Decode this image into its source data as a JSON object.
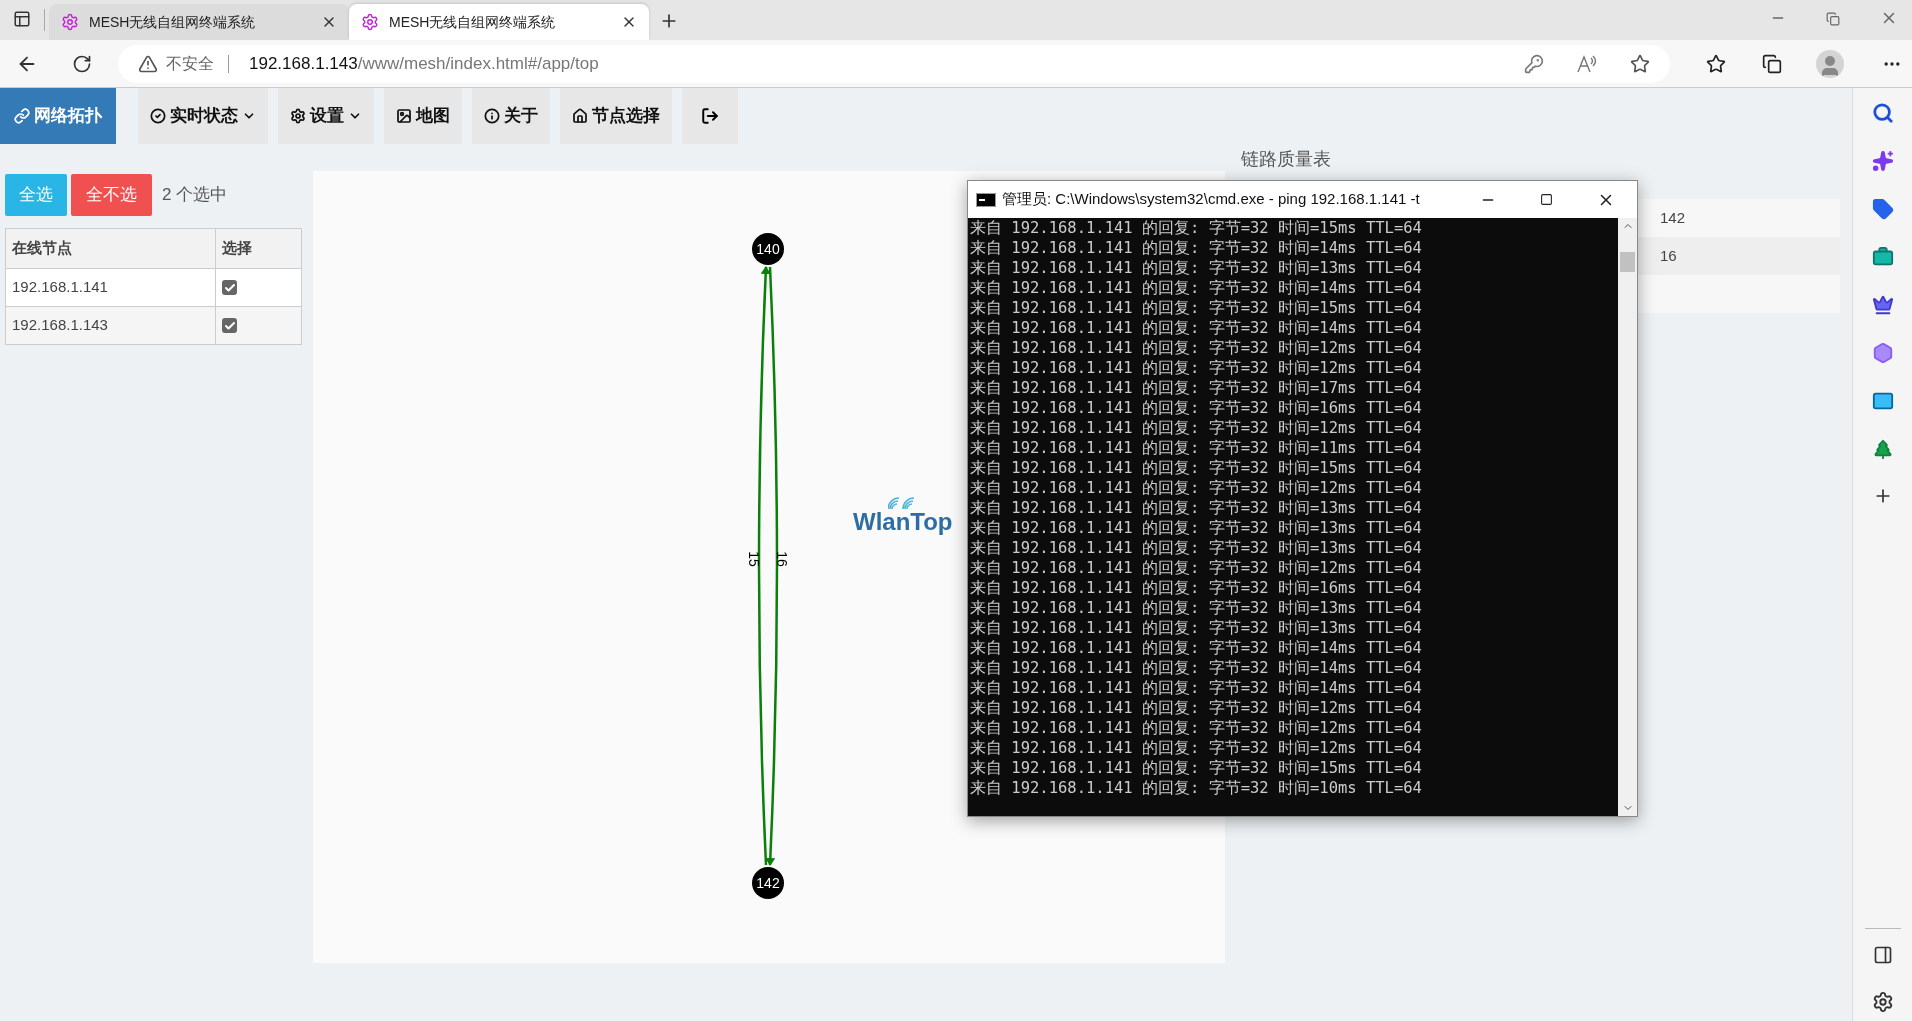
{
  "browser": {
    "tabs": [
      {
        "title": "MESH无线自组网终端系统",
        "selected": false
      },
      {
        "title": "MESH无线自组网终端系统",
        "selected": true
      }
    ],
    "security": "不安全",
    "url_host": "192.168.1.143",
    "url_path": "/www/mesh/index.html#/app/top"
  },
  "nav": [
    {
      "label": "网络拓扑",
      "dropdown": false,
      "selected": true
    },
    {
      "label": "实时状态",
      "dropdown": true,
      "selected": false
    },
    {
      "label": "设置",
      "dropdown": true,
      "selected": false
    },
    {
      "label": "地图",
      "dropdown": false,
      "selected": false
    },
    {
      "label": "关于",
      "dropdown": false,
      "selected": false
    },
    {
      "label": "节点选择",
      "dropdown": false,
      "selected": false
    }
  ],
  "node_panel": {
    "select_all": "全选",
    "select_none": "全不选",
    "selected_count": "2 个选中",
    "columns": [
      "在线节点",
      "选择"
    ],
    "rows": [
      {
        "ip": "192.168.1.141",
        "checked": true
      },
      {
        "ip": "192.168.1.143",
        "checked": true
      }
    ]
  },
  "graph": {
    "nodes": [
      "140",
      "142"
    ],
    "edges": [
      {
        "label": "15"
      },
      {
        "label": "16"
      }
    ],
    "logo": "WlanTop"
  },
  "link_quality": {
    "title": "链路质量表",
    "rows": [
      "142",
      "16"
    ]
  },
  "cmd": {
    "title": "管理员: C:\\Windows\\system32\\cmd.exe - ping  192.168.1.141 -t",
    "lines": [
      "来自 192.168.1.141 的回复: 字节=32 时间=15ms TTL=64",
      "来自 192.168.1.141 的回复: 字节=32 时间=14ms TTL=64",
      "来自 192.168.1.141 的回复: 字节=32 时间=13ms TTL=64",
      "来自 192.168.1.141 的回复: 字节=32 时间=14ms TTL=64",
      "来自 192.168.1.141 的回复: 字节=32 时间=15ms TTL=64",
      "来自 192.168.1.141 的回复: 字节=32 时间=14ms TTL=64",
      "来自 192.168.1.141 的回复: 字节=32 时间=12ms TTL=64",
      "来自 192.168.1.141 的回复: 字节=32 时间=12ms TTL=64",
      "来自 192.168.1.141 的回复: 字节=32 时间=17ms TTL=64",
      "来自 192.168.1.141 的回复: 字节=32 时间=16ms TTL=64",
      "来自 192.168.1.141 的回复: 字节=32 时间=12ms TTL=64",
      "来自 192.168.1.141 的回复: 字节=32 时间=11ms TTL=64",
      "来自 192.168.1.141 的回复: 字节=32 时间=15ms TTL=64",
      "来自 192.168.1.141 的回复: 字节=32 时间=12ms TTL=64",
      "来自 192.168.1.141 的回复: 字节=32 时间=13ms TTL=64",
      "来自 192.168.1.141 的回复: 字节=32 时间=13ms TTL=64",
      "来自 192.168.1.141 的回复: 字节=32 时间=13ms TTL=64",
      "来自 192.168.1.141 的回复: 字节=32 时间=12ms TTL=64",
      "来自 192.168.1.141 的回复: 字节=32 时间=16ms TTL=64",
      "来自 192.168.1.141 的回复: 字节=32 时间=13ms TTL=64",
      "来自 192.168.1.141 的回复: 字节=32 时间=13ms TTL=64",
      "来自 192.168.1.141 的回复: 字节=32 时间=14ms TTL=64",
      "来自 192.168.1.141 的回复: 字节=32 时间=14ms TTL=64",
      "来自 192.168.1.141 的回复: 字节=32 时间=14ms TTL=64",
      "来自 192.168.1.141 的回复: 字节=32 时间=12ms TTL=64",
      "来自 192.168.1.141 的回复: 字节=32 时间=12ms TTL=64",
      "来自 192.168.1.141 的回复: 字节=32 时间=12ms TTL=64",
      "来自 192.168.1.141 的回复: 字节=32 时间=15ms TTL=64",
      "来自 192.168.1.141 的回复: 字节=32 时间=10ms TTL=64"
    ]
  }
}
